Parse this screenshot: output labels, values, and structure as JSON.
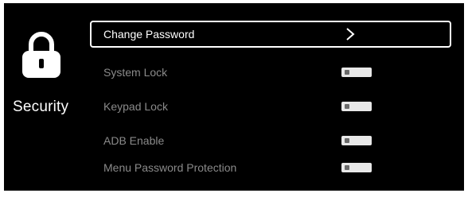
{
  "section": {
    "title": "Security",
    "icon": "lock-icon"
  },
  "menu": {
    "items": [
      {
        "label": "Change Password",
        "type": "submenu",
        "selected": true,
        "icon": "chevron-right-icon"
      },
      {
        "label": "System Lock",
        "type": "toggle",
        "selected": false,
        "state": "off"
      },
      {
        "label": "Keypad Lock",
        "type": "toggle",
        "selected": false,
        "state": "off"
      },
      {
        "label": "ADB Enable",
        "type": "toggle",
        "selected": false,
        "state": "off"
      },
      {
        "label": "Menu Password Protection",
        "type": "toggle",
        "selected": false,
        "state": "off"
      }
    ]
  },
  "colors": {
    "background": "#000000",
    "text_selected": "#ffffff",
    "text_dim": "#8a8a8a",
    "highlight_border": "#ffffff",
    "toggle_track": "#e8e8e8",
    "toggle_knob": "#6a6a6a"
  }
}
